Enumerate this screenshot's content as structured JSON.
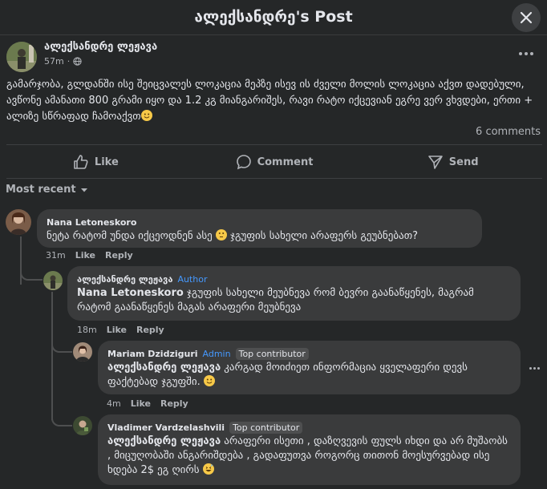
{
  "header": {
    "title": "ალექსანდრე's Post"
  },
  "post": {
    "author": "ალექსანდრე ლეჟავა",
    "time": "57m",
    "text": "გამარჯობა, გლდანში ისე შეიცვალეს ლოკაცია მეპზე ისევ ის ძველი მოლის ლოკაცია აქვთ დადებული, ავწონე ამანათი 800 გრამი იყო და 1.2 კგ მიანგარიშეს, რავი რატო იქცევიან ეგრე ვერ ვხვდები, ერთი + ალიზე სწრაფად ჩამოაქვთ",
    "comments_count": "6 comments"
  },
  "actions": {
    "like": "Like",
    "comment": "Comment",
    "send": "Send"
  },
  "sort": {
    "label": "Most recent"
  },
  "comments": [
    {
      "name": "Nana Letoneskoro",
      "text": "ნეტა რატომ უნდა იქცეოდნენ ასე",
      "text2": "ჯგუფის სახელი არაფერს გეუბნებათ?",
      "time": "31m",
      "like": "Like",
      "reply": "Reply"
    },
    {
      "name": "ალექსანდრე ლეჟავა",
      "badge": "Author",
      "mention": "Nana Letoneskoro",
      "text": "ჯგუფის სახელი მეუბნევა რომ ბევრი გაანაწყენეს, მაგრამ რატომ გაანაწყენეს მაგას არაფერი მეუბნევა",
      "time": "18m",
      "like": "Like",
      "reply": "Reply"
    },
    {
      "name": "Mariam Dzidziguri",
      "badge_admin": "Admin",
      "badge_top": "Top contributor",
      "mention": "ალექსანდრე ლეჟავა",
      "text": "კარგად მოიძიეთ ინფორმაცია ყველაფერი დევს ფაქტებად ჯგუფში.",
      "time": "4m",
      "like": "Like",
      "reply": "Reply"
    },
    {
      "name": "Vladimer Vardzelashvili",
      "badge_top": "Top contributor",
      "mention": "ალექსანდრე ლეჟავა",
      "text": "არაფერი ისეთი , დაზღვევის ფულს იხდი და არ მუშაობს , მიცუღობაში ანგარიშდება , გადაფუთვა როგორც თითონ მოესურვებად ისე ხდება 2$ ეგ ღირს"
    }
  ]
}
